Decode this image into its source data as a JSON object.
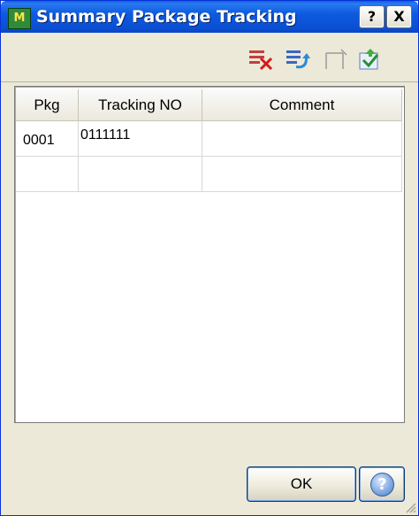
{
  "window": {
    "title": "Summary Package Tracking",
    "help_glyph": "?",
    "close_glyph": "X",
    "app_icon_letters": "M"
  },
  "toolbar": {
    "items": [
      {
        "name": "delete-row-icon"
      },
      {
        "name": "insert-row-icon"
      },
      {
        "name": "blank-icon"
      },
      {
        "name": "import-icon"
      }
    ]
  },
  "grid": {
    "columns": [
      "Pkg",
      "Tracking NO",
      "Comment"
    ],
    "rows": [
      {
        "pkg": "0001",
        "tracking_no": "0111111",
        "comment": ""
      },
      {
        "pkg": "",
        "tracking_no": "",
        "comment": ""
      }
    ]
  },
  "buttons": {
    "ok_label": "OK",
    "help_glyph": "?"
  }
}
